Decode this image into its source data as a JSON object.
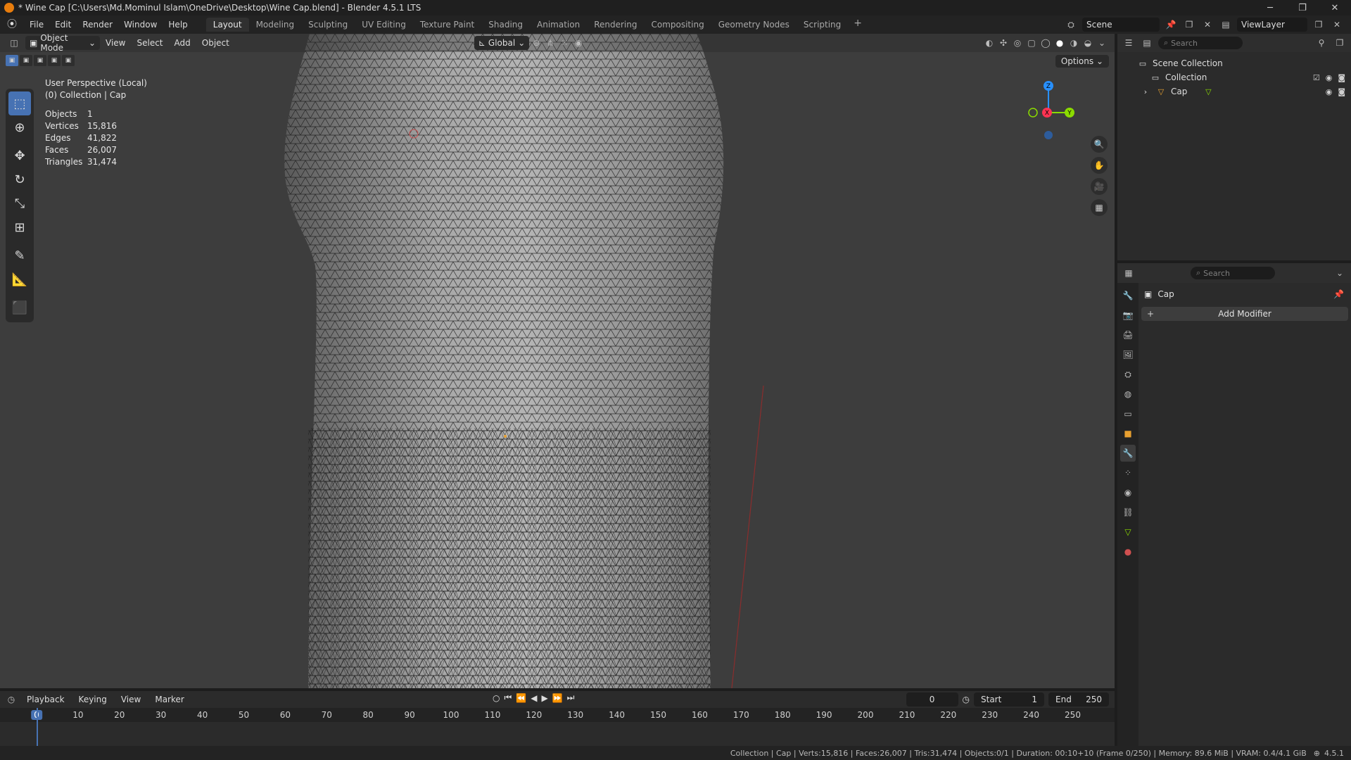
{
  "window": {
    "title": "* Wine Cap [C:\\Users\\Md.Mominul Islam\\OneDrive\\Desktop\\Wine Cap.blend] - Blender 4.5.1 LTS",
    "minimize": "─",
    "maximize": "❐",
    "close": "✕"
  },
  "menu": {
    "items": [
      "File",
      "Edit",
      "Render",
      "Window",
      "Help"
    ]
  },
  "workspaces": {
    "tabs": [
      "Layout",
      "Modeling",
      "Sculpting",
      "UV Editing",
      "Texture Paint",
      "Shading",
      "Animation",
      "Rendering",
      "Compositing",
      "Geometry Nodes",
      "Scripting"
    ],
    "active": "Layout",
    "add": "+"
  },
  "scene": {
    "name": "Scene",
    "view_layer": "ViewLayer"
  },
  "viewport": {
    "mode": "Object Mode",
    "menus": [
      "View",
      "Select",
      "Add",
      "Object"
    ],
    "transform_orientation": "Global",
    "options": "Options",
    "perspective": "User Perspective (Local)",
    "collection_path": "(0) Collection | Cap",
    "stats": [
      {
        "label": "Objects",
        "value": "1"
      },
      {
        "label": "Vertices",
        "value": "15,816"
      },
      {
        "label": "Edges",
        "value": "41,822"
      },
      {
        "label": "Faces",
        "value": "26,007"
      },
      {
        "label": "Triangles",
        "value": "31,474"
      }
    ],
    "gizmo_axes": {
      "x": "X",
      "y": "Y",
      "z": "Z"
    },
    "colors": {
      "background": "#3d3d3d",
      "x_axis": "#ff3352",
      "y_axis": "#8bdc00",
      "z_axis": "#2890ff",
      "active": "#4772b3"
    }
  },
  "outliner": {
    "search_placeholder": "Search",
    "scene_collection": "Scene Collection",
    "collection": "Collection",
    "object": "Cap"
  },
  "properties": {
    "search_placeholder": "Search",
    "object_name": "Cap",
    "add_modifier": "Add Modifier",
    "tabs": [
      "tool-icon",
      "render-icon",
      "output-icon",
      "view-layer-icon",
      "scene-icon",
      "world-icon",
      "collection-icon",
      "object-icon",
      "modifier-icon",
      "particles-icon",
      "physics-icon",
      "constraints-icon",
      "data-icon",
      "material-icon"
    ],
    "active_tab": "modifier-icon"
  },
  "timeline": {
    "menus": [
      "Playback",
      "Keying",
      "View",
      "Marker"
    ],
    "current_frame": "0",
    "start_label": "Start",
    "start": "1",
    "end_label": "End",
    "end": "250",
    "ticks": [
      "0",
      "10",
      "20",
      "30",
      "40",
      "50",
      "60",
      "70",
      "80",
      "90",
      "100",
      "110",
      "120",
      "130",
      "140",
      "150",
      "160",
      "170",
      "180",
      "190",
      "200",
      "210",
      "220",
      "230",
      "240",
      "250"
    ]
  },
  "statusbar": {
    "text": "Collection | Cap | Verts:15,816 | Faces:26,007 | Tris:31,474 | Objects:0/1 | Duration: 00:10+10 (Frame 0/250) | Memory: 89.6 MiB | VRAM: 0.4/4.1 GiB",
    "version": "4.5.1"
  }
}
